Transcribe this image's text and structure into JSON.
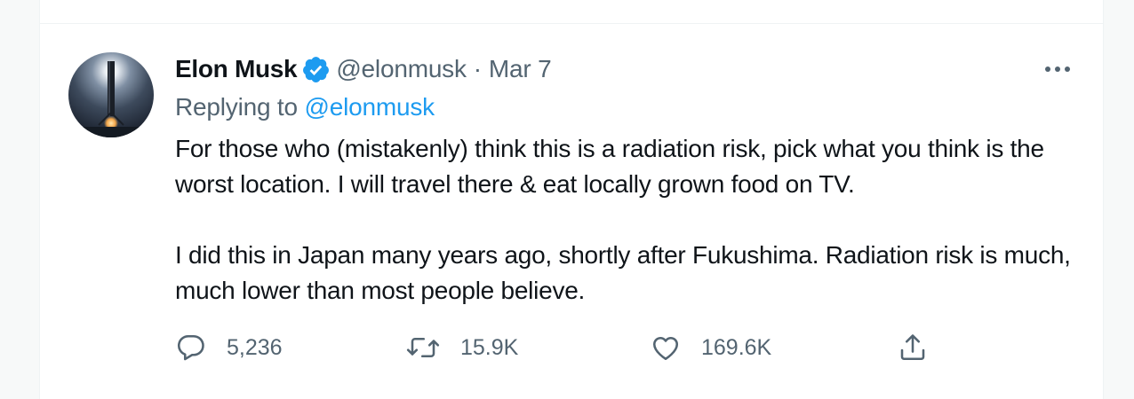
{
  "tweet": {
    "display_name": "Elon Musk",
    "verified_icon": "verified-badge-icon",
    "handle": "@elonmusk",
    "separator": "·",
    "date": "Mar 7",
    "replying_prefix": "Replying to",
    "replying_to": "@elonmusk",
    "paragraphs": [
      "For those who (mistakenly) think this is a radiation risk, pick what you think is the worst location. I will travel there & eat locally grown food on TV.",
      "I did this in Japan many years ago, shortly after Fukushima. Radiation risk is much, much lower than most people believe."
    ],
    "more_icon": "more-options-icon"
  },
  "actions": {
    "reply": {
      "icon": "reply-icon",
      "count": "5,236"
    },
    "retweet": {
      "icon": "retweet-icon",
      "count": "15.9K"
    },
    "like": {
      "icon": "heart-icon",
      "count": "169.6K"
    },
    "share": {
      "icon": "share-icon"
    }
  },
  "colors": {
    "text_primary": "#0f1419",
    "text_secondary": "#536471",
    "accent": "#1d9bf0",
    "border": "#eff3f4"
  }
}
